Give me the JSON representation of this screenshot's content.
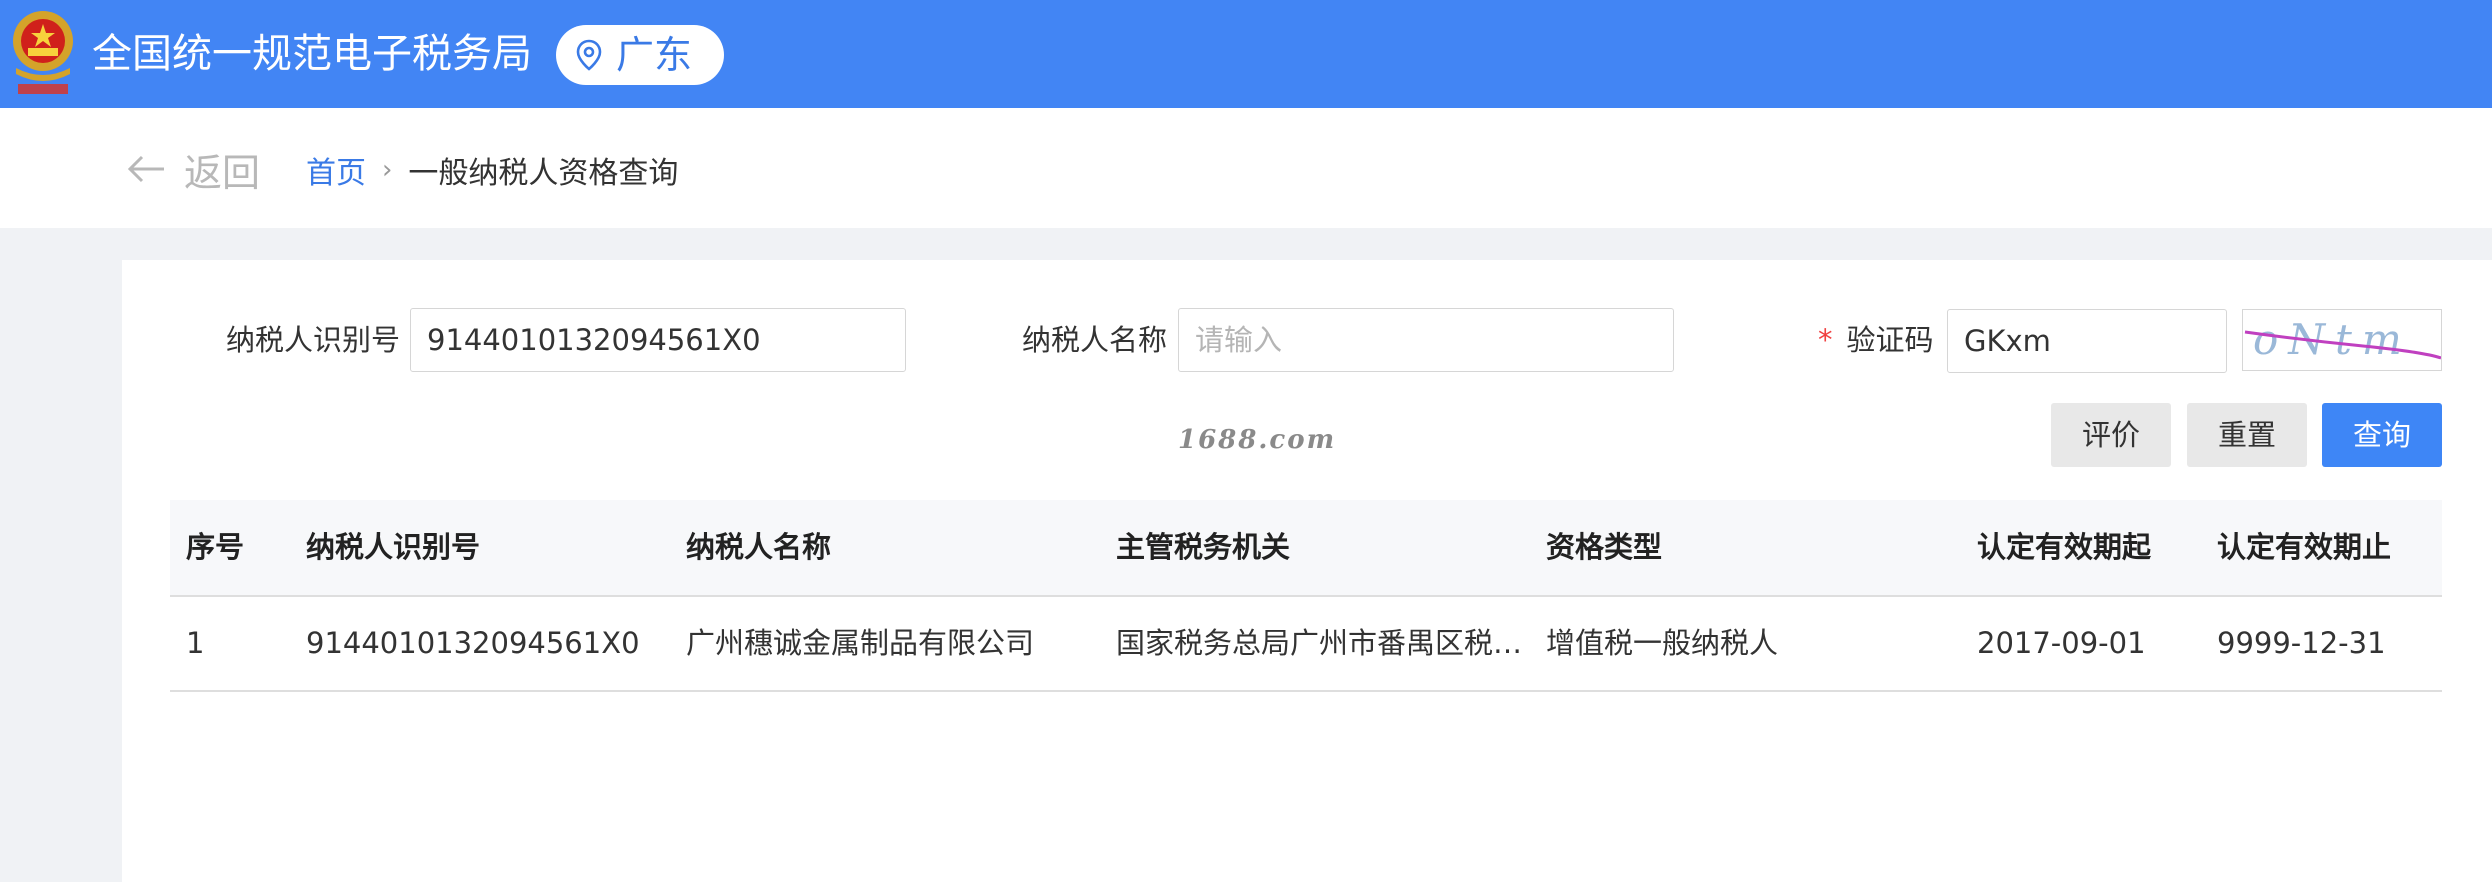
{
  "header": {
    "site_title": "全国统一规范电子税务局",
    "region": "广东",
    "emblem_icon": "national-emblem-icon",
    "location_icon": "map-pin-icon",
    "bar_color": "#4285f4"
  },
  "nav": {
    "back_label": "返回",
    "breadcrumb": {
      "home": "首页",
      "separator": "›",
      "current": "一般纳税人资格查询"
    }
  },
  "form": {
    "taxpayer_id": {
      "label": "纳税人识别号",
      "value": "9144010132094561X0",
      "placeholder": ""
    },
    "taxpayer_name": {
      "label": "纳税人名称",
      "value": "",
      "placeholder": "请输入"
    },
    "captcha": {
      "required_mark": "*",
      "label": "验证码",
      "value": "GKxm",
      "image_text": "oNtm"
    },
    "watermark": "1688.com",
    "buttons": {
      "evaluate": "评价",
      "reset": "重置",
      "query": "查询"
    }
  },
  "table": {
    "columns": [
      "序号",
      "纳税人识别号",
      "纳税人名称",
      "主管税务机关",
      "资格类型",
      "认定有效期起",
      "认定有效期止"
    ],
    "rows": [
      [
        "1",
        "9144010132094561X0",
        "广州穗诚金属制品有限公司",
        "国家税务总局广州市番禺区税…",
        "增值税一般纳税人",
        "2017-09-01",
        "9999-12-31"
      ]
    ]
  },
  "colors": {
    "accent": "#3e86f6",
    "link": "#3a7ae6",
    "required": "#f04040"
  }
}
